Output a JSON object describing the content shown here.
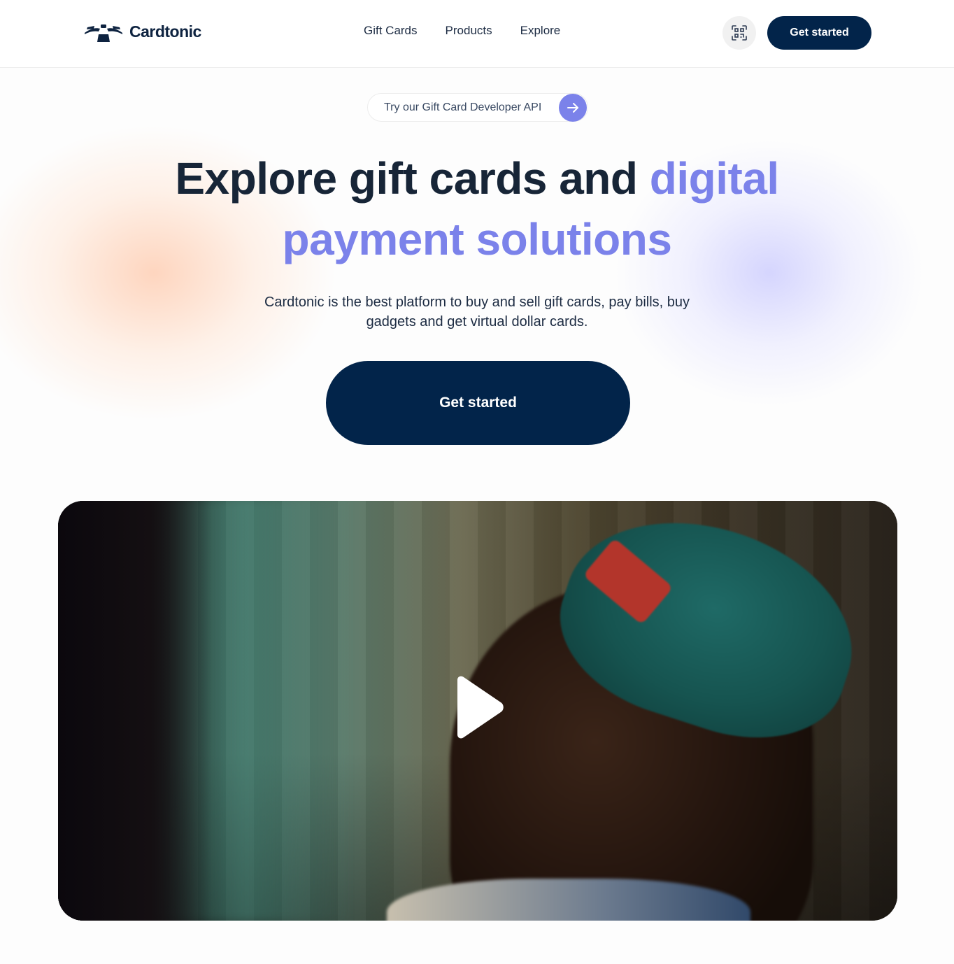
{
  "header": {
    "logo_text": "Cardtonic",
    "nav": [
      {
        "label": "Gift Cards"
      },
      {
        "label": "Products"
      },
      {
        "label": "Explore"
      }
    ],
    "cta_label": "Get started"
  },
  "hero": {
    "api_pill_text": "Try our Gift Card Developer API",
    "title_part1": "Explore gift cards and ",
    "title_accent": "digital payment solutions",
    "subtitle": "Cardtonic is the best platform to buy and sell gift cards, pay bills, buy gadgets and get virtual dollar cards.",
    "cta_label": "Get started"
  },
  "colors": {
    "navy": "#02244a",
    "accent": "#7b82ea",
    "text": "#172537"
  },
  "icons": {
    "qr": "qr-scan-icon",
    "arrow": "arrow-right-icon",
    "play": "play-icon"
  }
}
